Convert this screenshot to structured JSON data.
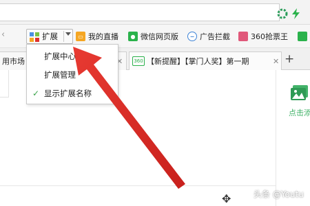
{
  "toolbar": {
    "extensions_label": "扩展",
    "bookmarks": [
      {
        "label": "我的直播",
        "icon": "tv-icon",
        "color": "#f5a623"
      },
      {
        "label": "微信网页版",
        "icon": "wechat-icon",
        "color": "#2bb24c"
      },
      {
        "label": "广告拦截",
        "icon": "block-icon",
        "color": "#3c82d6"
      },
      {
        "label": "360抢票王",
        "icon": "ticket-icon",
        "color": "#e0587a"
      }
    ]
  },
  "extensions_menu": {
    "items": [
      {
        "label": "扩展中心"
      },
      {
        "label": "扩展管理"
      },
      {
        "label": "显示扩展名称",
        "checked": true
      }
    ]
  },
  "tabs": [
    {
      "label": "用市场"
    },
    {
      "label": "【新提醒】【掌门人奖】第一期",
      "icon_text": "360"
    }
  ],
  "new_tab_label": "+",
  "right_panel": {
    "label": "点击添"
  },
  "watermark": "头条 @Youtu",
  "colors": {
    "accent_red": "#e0302c",
    "check_green": "#3aa34a"
  }
}
